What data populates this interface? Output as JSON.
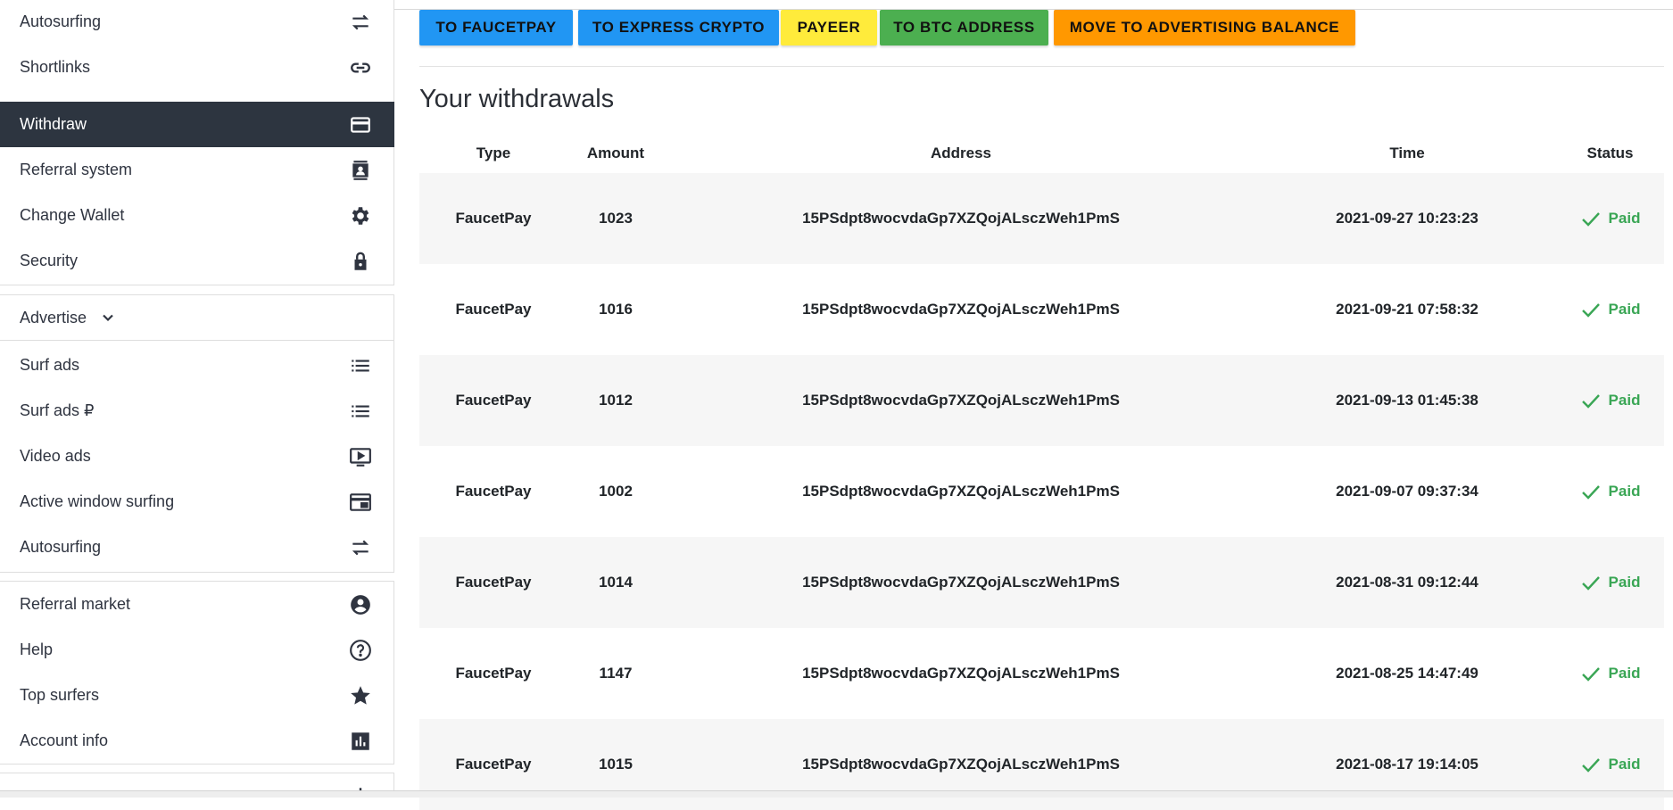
{
  "sidebar": {
    "group1": [
      {
        "label": "Autosurfing",
        "icon": "repeat-icon"
      },
      {
        "label": "Shortlinks",
        "icon": "link-icon"
      },
      {
        "label": "Withdraw",
        "icon": "credit-card-icon",
        "active": true
      },
      {
        "label": "Referral system",
        "icon": "contact-card-icon"
      },
      {
        "label": "Change Wallet",
        "icon": "gear-icon"
      },
      {
        "label": "Security",
        "icon": "lock-icon"
      }
    ],
    "advertise_label": "Advertise",
    "advertise": [
      {
        "label": "Surf ads",
        "icon": "list-icon"
      },
      {
        "label": "Surf ads ₽",
        "icon": "list-icon"
      },
      {
        "label": "Video ads",
        "icon": "video-icon"
      },
      {
        "label": "Active window surfing",
        "icon": "window-icon"
      },
      {
        "label": "Autosurfing",
        "icon": "repeat-icon"
      }
    ],
    "group3": [
      {
        "label": "Referral market",
        "icon": "user-circle-icon"
      },
      {
        "label": "Help",
        "icon": "help-icon"
      },
      {
        "label": "Top surfers",
        "icon": "star-icon"
      },
      {
        "label": "Account info",
        "icon": "chart-icon"
      }
    ]
  },
  "buttons": [
    {
      "label": "TO FAUCETPAY",
      "color": "#2196f3"
    },
    {
      "label": "TO EXPRESS CRYPTO",
      "color": "#2196f3"
    },
    {
      "label": "PAYEER",
      "color": "#ffeb3b"
    },
    {
      "label": "TO BTC ADDRESS",
      "color": "#4caf50"
    },
    {
      "label": "MOVE TO ADVERTISING BALANCE",
      "color": "#ff9800"
    }
  ],
  "withdrawals": {
    "title": "Your withdrawals",
    "headers": {
      "type": "Type",
      "amount": "Amount",
      "address": "Address",
      "time": "Time",
      "status": "Status"
    },
    "rows": [
      {
        "type": "FaucetPay",
        "amount": "1023",
        "address": "15PSdpt8wocvdaGp7XZQojALsczWeh1PmS",
        "time": "2021-09-27 10:23:23",
        "status": "Paid"
      },
      {
        "type": "FaucetPay",
        "amount": "1016",
        "address": "15PSdpt8wocvdaGp7XZQojALsczWeh1PmS",
        "time": "2021-09-21 07:58:32",
        "status": "Paid"
      },
      {
        "type": "FaucetPay",
        "amount": "1012",
        "address": "15PSdpt8wocvdaGp7XZQojALsczWeh1PmS",
        "time": "2021-09-13 01:45:38",
        "status": "Paid"
      },
      {
        "type": "FaucetPay",
        "amount": "1002",
        "address": "15PSdpt8wocvdaGp7XZQojALsczWeh1PmS",
        "time": "2021-09-07 09:37:34",
        "status": "Paid"
      },
      {
        "type": "FaucetPay",
        "amount": "1014",
        "address": "15PSdpt8wocvdaGp7XZQojALsczWeh1PmS",
        "time": "2021-08-31 09:12:44",
        "status": "Paid"
      },
      {
        "type": "FaucetPay",
        "amount": "1147",
        "address": "15PSdpt8wocvdaGp7XZQojALsczWeh1PmS",
        "time": "2021-08-25 14:47:49",
        "status": "Paid"
      },
      {
        "type": "FaucetPay",
        "amount": "1015",
        "address": "15PSdpt8wocvdaGp7XZQojALsczWeh1PmS",
        "time": "2021-08-17 19:14:05",
        "status": "Paid"
      }
    ],
    "status_color": "#3aa655"
  }
}
